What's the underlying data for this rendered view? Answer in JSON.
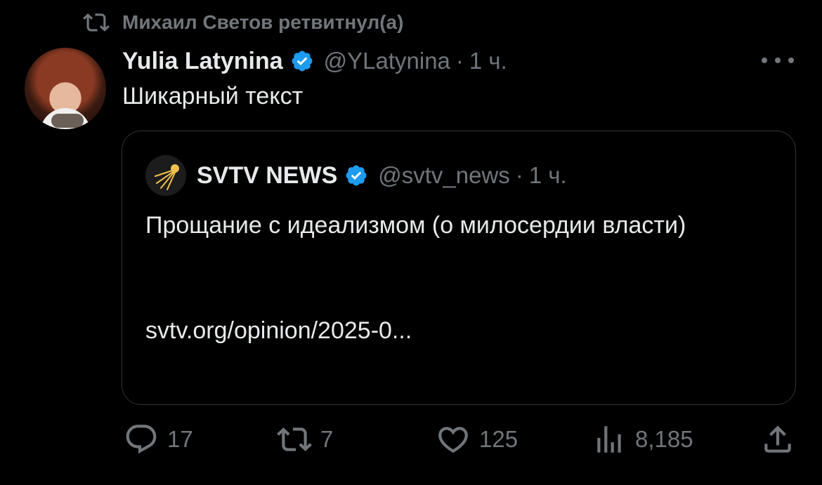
{
  "retweet_banner": {
    "icon": "retweet-icon",
    "text": "Михаил Светов ретвитнул(а)"
  },
  "tweet": {
    "author_name": "Yulia Latynina",
    "verified": true,
    "handle": "@YLatynina",
    "separator": "·",
    "time": "1 ч.",
    "text": "Шикарный текст",
    "more_icon": "more-dots-icon"
  },
  "quote": {
    "author_name": "SVTV NEWS",
    "verified": true,
    "handle": "@svtv_news",
    "separator": "·",
    "time": "1 ч.",
    "text": "Прощание с идеализмом (о милосердии власти)",
    "link": "svtv.org/opinion/2025-0..."
  },
  "actions": {
    "reply_count": "17",
    "retweet_count": "7",
    "like_count": "125",
    "views_count": "8,185"
  },
  "colors": {
    "background": "#000000",
    "primary_text": "#e7e9ea",
    "secondary_text": "#71767b",
    "verified_blue": "#1d9bf0",
    "border": "#2f3336"
  }
}
